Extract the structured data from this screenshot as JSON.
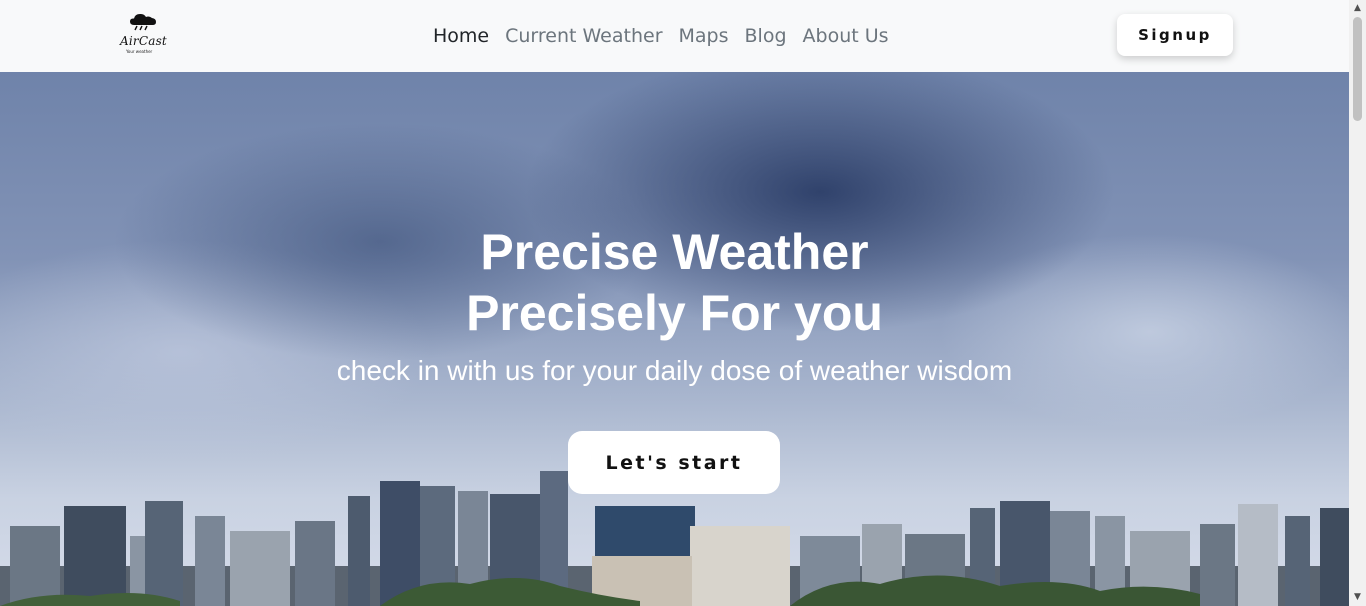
{
  "brand": {
    "name": "AirCast",
    "tagline": "Your weather",
    "icon": "cloud-rain-icon"
  },
  "nav": {
    "items": [
      {
        "label": "Home",
        "active": true
      },
      {
        "label": "Current Weather",
        "active": false
      },
      {
        "label": "Maps",
        "active": false
      },
      {
        "label": "Blog",
        "active": false
      },
      {
        "label": "About Us",
        "active": false
      }
    ],
    "signup_label": "Signup"
  },
  "hero": {
    "title_line1": "Precise Weather",
    "title_line2": "Precisely For you",
    "subtitle": "check in with us for your daily dose of weather wisdom",
    "cta_label": "Let's start"
  },
  "colors": {
    "nav_bg": "#f8f9fa",
    "nav_active": "#212529",
    "nav_inactive": "#6c757d",
    "hero_text": "#ffffff",
    "button_bg": "#ffffff"
  }
}
